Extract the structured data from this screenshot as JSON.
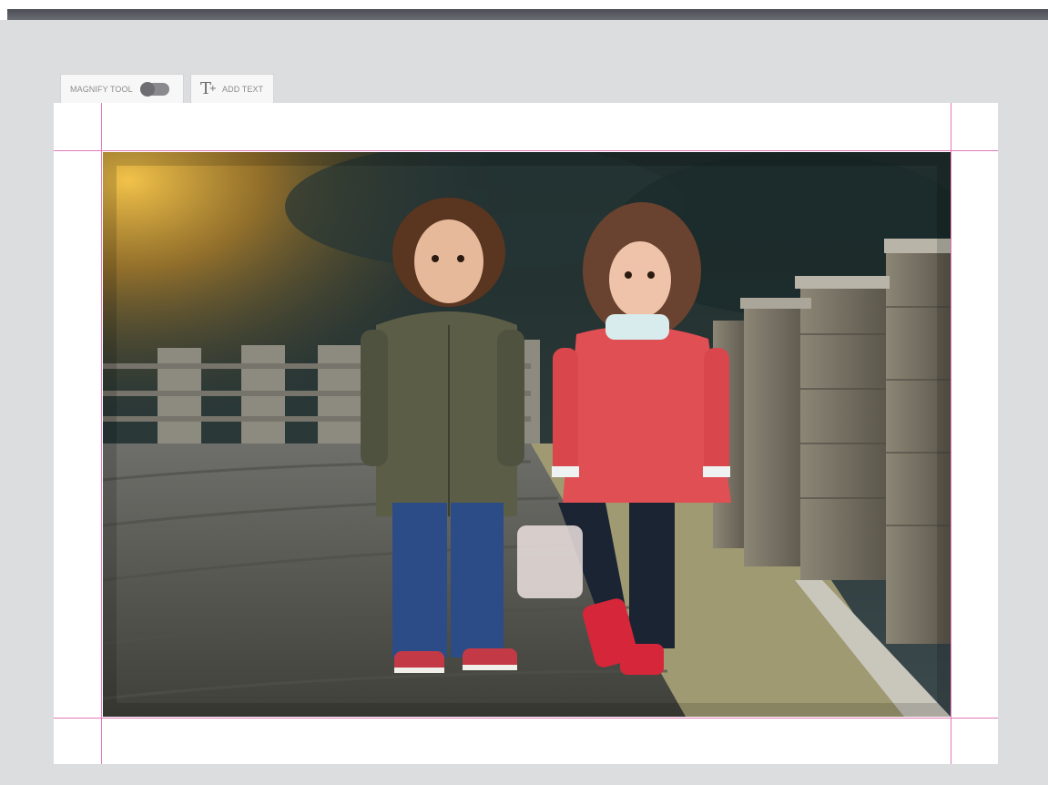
{
  "toolbar": {
    "magnify_label": "MAGNIFY TOOL",
    "magnify_enabled": false,
    "add_text_label": "ADD TEXT",
    "add_text_icon": "text-add-icon"
  },
  "canvas": {
    "photo_subject": "two children standing on a stone-paved path",
    "guide_color": "#e07ab8"
  },
  "colors": {
    "workspace_bg": "#dcdddf",
    "topbar": "#55575e",
    "canvas_bg": "#ffffff"
  }
}
